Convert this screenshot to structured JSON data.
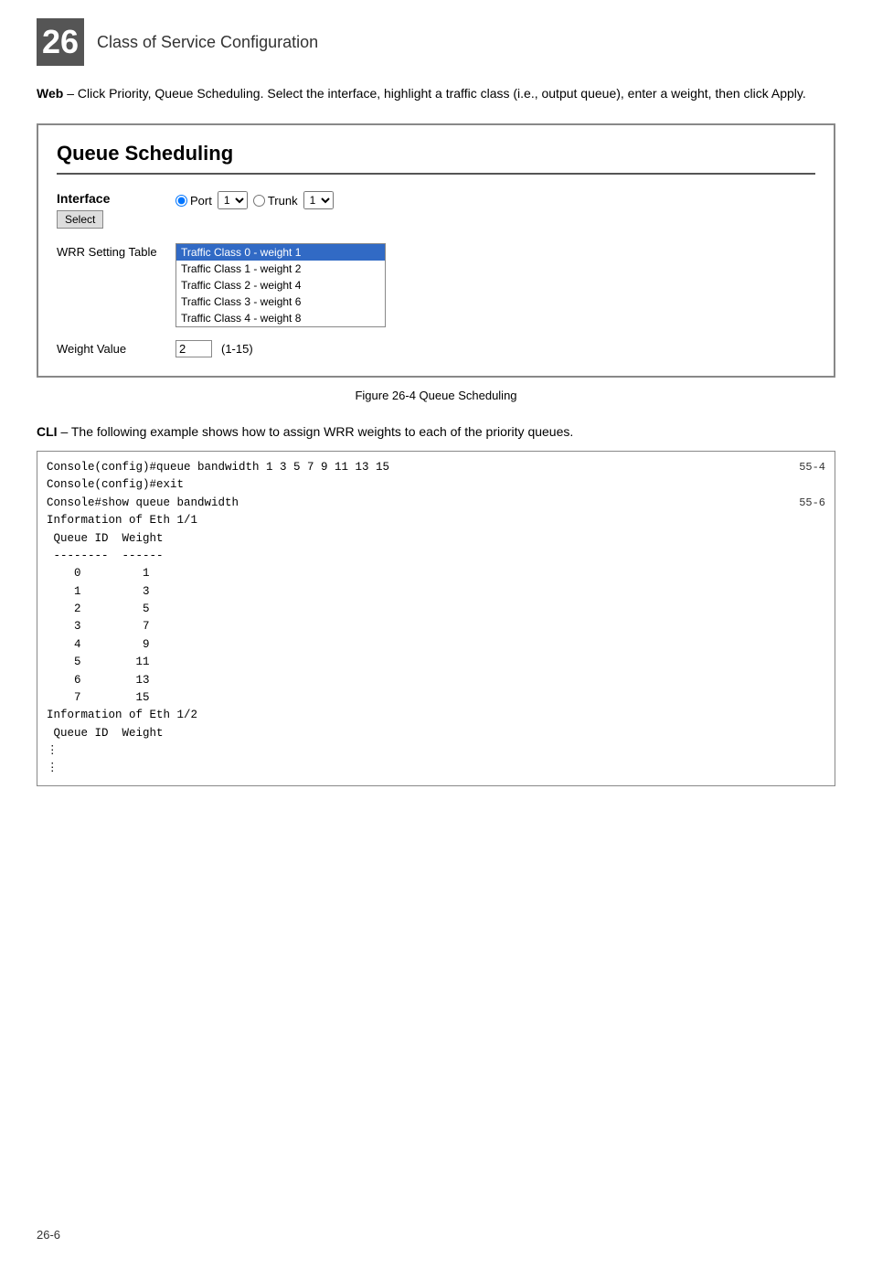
{
  "header": {
    "chapter_num": "26",
    "title": "Class of Service Configuration"
  },
  "intro": {
    "text_html": "<strong>Web</strong> – Click Priority, Queue Scheduling. Select the interface, highlight a traffic class (i.e., output queue), enter a weight, then click Apply."
  },
  "queue_scheduling": {
    "title": "Queue Scheduling",
    "interface_label": "Interface",
    "select_button": "Select",
    "port_radio_label": "Port",
    "trunk_radio_label": "Trunk",
    "port_value": "1",
    "trunk_value": "1",
    "port_selected": true,
    "wrr_label": "WRR Setting Table",
    "traffic_classes": [
      {
        "label": "Traffic Class 0 - weight 1",
        "selected": true
      },
      {
        "label": "Traffic Class 1 - weight 2",
        "selected": false
      },
      {
        "label": "Traffic Class 2 - weight 4",
        "selected": false
      },
      {
        "label": "Traffic Class 3 - weight 6",
        "selected": false
      },
      {
        "label": "Traffic Class 4 - weight 8",
        "selected": false
      }
    ],
    "weight_label": "Weight Value",
    "weight_value": "2",
    "weight_range": "(1-15)"
  },
  "figure_caption": "Figure 26-4  Queue Scheduling",
  "cli_intro": {
    "bold": "CLI",
    "rest": " – The following example shows how to assign WRR weights to each of the priority queues."
  },
  "code": {
    "lines": [
      {
        "text": "Console(config)#queue bandwidth 1 3 5 7 9 11 13 15",
        "ref": "55-4"
      },
      {
        "text": "Console(config)#exit",
        "ref": ""
      },
      {
        "text": "Console#show queue bandwidth",
        "ref": "55-6"
      },
      {
        "text": "Information of Eth 1/1",
        "ref": ""
      },
      {
        "text": " Queue ID  Weight",
        "ref": ""
      },
      {
        "text": " --------  ------",
        "ref": ""
      },
      {
        "text": "    0         1",
        "ref": ""
      },
      {
        "text": "    1         3",
        "ref": ""
      },
      {
        "text": "    2         5",
        "ref": ""
      },
      {
        "text": "    3         7",
        "ref": ""
      },
      {
        "text": "    4         9",
        "ref": ""
      },
      {
        "text": "    5        11",
        "ref": ""
      },
      {
        "text": "    6        13",
        "ref": ""
      },
      {
        "text": "    7        15",
        "ref": ""
      },
      {
        "text": "Information of Eth 1/2",
        "ref": ""
      },
      {
        "text": " Queue ID  Weight",
        "ref": ""
      },
      {
        "text": "⋮",
        "ref": ""
      },
      {
        "text": "⋮",
        "ref": ""
      }
    ]
  },
  "footer": {
    "page": "26-6"
  }
}
